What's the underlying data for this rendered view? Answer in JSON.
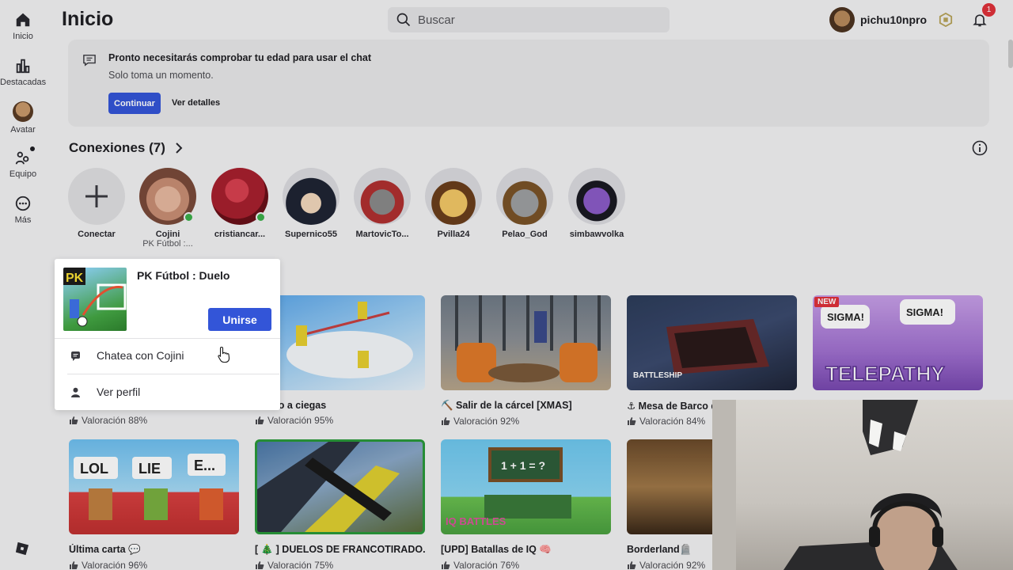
{
  "sidebar": {
    "items": [
      {
        "label": "Inicio",
        "icon": "home-icon"
      },
      {
        "label": "Destacadas",
        "icon": "charts-icon"
      },
      {
        "label": "Avatar",
        "icon": "avatar-icon"
      },
      {
        "label": "Equipo",
        "icon": "team-icon"
      },
      {
        "label": "Más",
        "icon": "more-icon"
      }
    ]
  },
  "header": {
    "title": "Inicio",
    "search_placeholder": "Buscar",
    "username": "pichu10npro",
    "notifications_count": "1"
  },
  "banner": {
    "title": "Pronto necesitarás comprobar tu edad para usar el chat",
    "subtitle": "Solo toma un momento.",
    "continue_label": "Continuar",
    "details_label": "Ver detalles"
  },
  "connections": {
    "title": "Conexiones (7)",
    "connect_label": "Conectar",
    "friends": [
      {
        "name": "Cojini",
        "game": "PK Fútbol :...",
        "online": true
      },
      {
        "name": "cristiancar...",
        "game": "",
        "online": true
      },
      {
        "name": "Supernico55",
        "game": "",
        "online": false
      },
      {
        "name": "MartovicTo...",
        "game": "",
        "online": false
      },
      {
        "name": "Pvilla24",
        "game": "",
        "online": false
      },
      {
        "name": "Pelao_God",
        "game": "",
        "online": false
      },
      {
        "name": "simbawvolka",
        "game": "",
        "online": false
      }
    ]
  },
  "games": [
    {
      "title": "Tiro a ciegas",
      "rating": "Valoración 95%"
    },
    {
      "title": "⛏️ Salir de la cárcel [XMAS]",
      "rating": "Valoración 92%"
    },
    {
      "title": "⚓ Mesa de Barco d",
      "rating": "Valoración 84%"
    },
    {
      "title": "",
      "rating": "",
      "badge": "NEW"
    },
    {
      "title": "Última carta 💬",
      "rating": "Valoración 96%"
    },
    {
      "title": "[ 🎄 ] DUELOS DE FRANCOTIRADO...",
      "rating": "Valoración 75%"
    },
    {
      "title": "[UPD] Batallas de IQ 🧠",
      "rating": "Valoración 76%"
    },
    {
      "title": "Borderland🪦",
      "rating": "Valoración 92%"
    },
    {
      "title": "",
      "rating": "Valoración 88%"
    }
  ],
  "thumbnails_text": {
    "lol": "LOL",
    "lie": "LIE",
    "e": "E...",
    "sigma1": "SIGMA!",
    "sigma2": "SIGMA!",
    "telepathy": "TELEPATHY",
    "battleship": "BATTLESHIP",
    "iq_eq": "1 + 1 = ?",
    "iq_logo": "IQ BATTLES",
    "pk": "PK"
  },
  "popup": {
    "game_title": "PK Fútbol : Duelo",
    "join_label": "Unirse",
    "chat_label": "Chatea con Cojini",
    "profile_label": "Ver perfil"
  }
}
